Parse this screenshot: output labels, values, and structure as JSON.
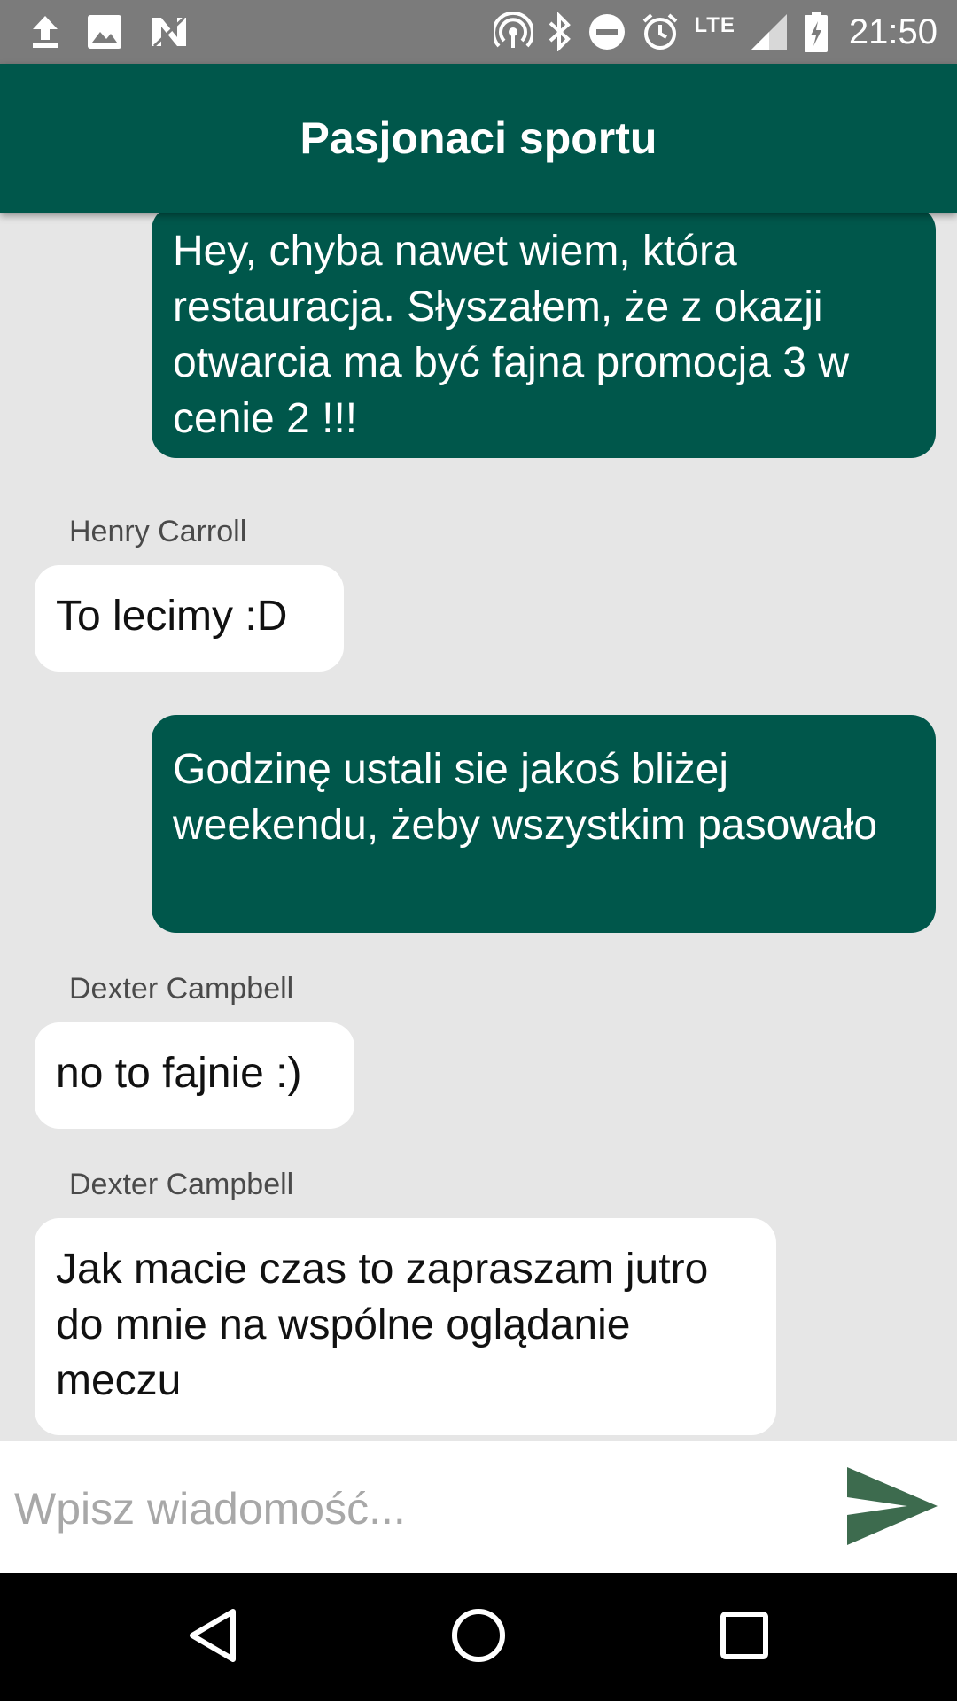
{
  "status_bar": {
    "icons_left": [
      "upload-icon",
      "image-icon",
      "app-n-icon"
    ],
    "icons_right": [
      "hotspot-icon",
      "bluetooth-icon",
      "do-not-disturb-icon",
      "alarm-icon",
      "signal-icon",
      "battery-charging-icon"
    ],
    "network": "LTE",
    "time": "21:50"
  },
  "app_bar": {
    "title": "Pasjonaci sportu"
  },
  "messages": [
    {
      "direction": "out",
      "text": "Hey, chyba nawet wiem, która restauracja. Słyszałem, że z okazji otwarcia ma być fajna promocja 3 w cenie 2 !!!"
    },
    {
      "direction": "in",
      "sender": "Henry Carroll",
      "text": "To lecimy :D"
    },
    {
      "direction": "out",
      "text": "Godzinę ustali sie jakoś bliżej weekendu, żeby wszystkim pasowało"
    },
    {
      "direction": "in",
      "sender": "Dexter Campbell",
      "text": "no to fajnie :)"
    },
    {
      "direction": "in",
      "sender": "Dexter Campbell",
      "text": "Jak macie czas to zapraszam jutro do mnie na wspólne oglądanie meczu"
    }
  ],
  "composer": {
    "placeholder": "Wpisz wiadomość...",
    "value": "",
    "send_icon": "send-icon"
  },
  "nav_bar": {
    "buttons": [
      "back-icon",
      "home-icon",
      "recents-icon"
    ]
  },
  "colors": {
    "primary": "#00574b",
    "background": "#e6e6e6",
    "incoming_bubble": "#ffffff",
    "send_icon": "#3d6b4e",
    "status_bar": "#7b7b7b"
  }
}
